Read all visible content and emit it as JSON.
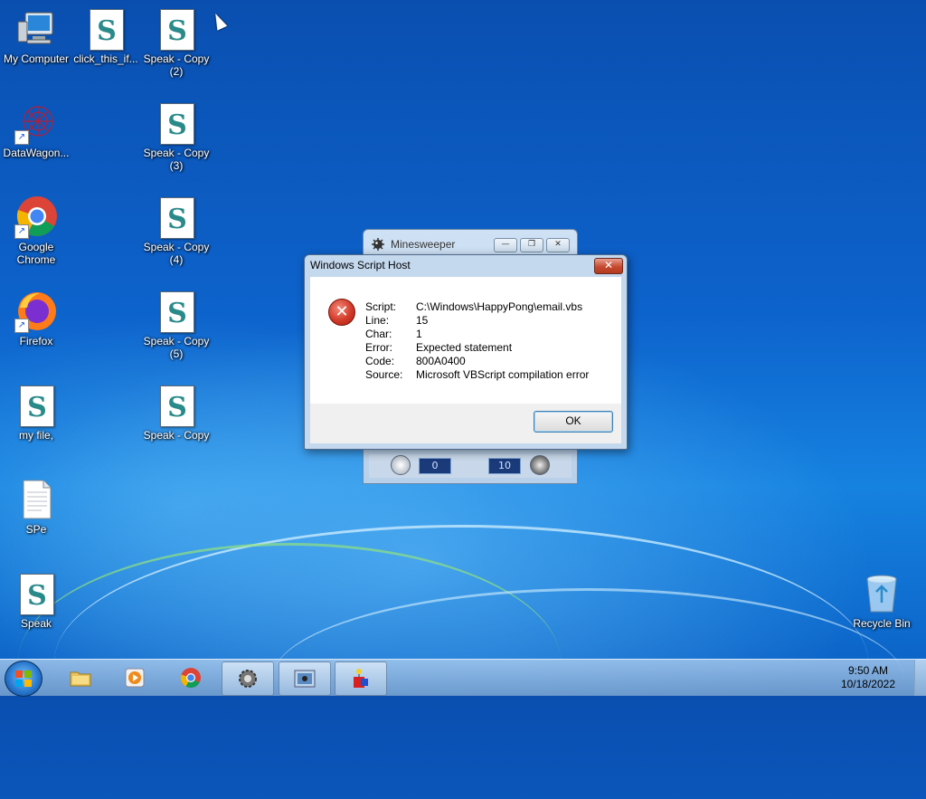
{
  "desktop": {
    "icons": [
      {
        "label": "My Computer",
        "icon": "computer-icon"
      },
      {
        "label": "click_this_if...",
        "icon": "script-file-icon"
      },
      {
        "label": "Speak - Copy\n(2)",
        "icon": "script-file-icon"
      },
      {
        "label": "DataWagon...",
        "icon": "datawagon-icon"
      },
      {
        "label": "Speak - Copy\n(3)",
        "icon": "script-file-icon"
      },
      {
        "label": "Google\nChrome",
        "icon": "chrome-icon"
      },
      {
        "label": "Speak - Copy\n(4)",
        "icon": "script-file-icon"
      },
      {
        "label": "Firefox",
        "icon": "firefox-icon"
      },
      {
        "label": "Speak - Copy\n(5)",
        "icon": "script-file-icon"
      },
      {
        "label": "my file,",
        "icon": "script-file-icon"
      },
      {
        "label": "Speak - Copy",
        "icon": "script-file-icon"
      },
      {
        "label": "SPe",
        "icon": "text-file-icon"
      },
      {
        "label": "Speak",
        "icon": "script-file-icon"
      },
      {
        "label": "Recycle Bin",
        "icon": "recycle-bin-icon"
      }
    ]
  },
  "minesweeper": {
    "title": "Minesweeper",
    "time": "0",
    "mines": "10",
    "minimize": "—",
    "restore": "❐",
    "close": "✕"
  },
  "dialog": {
    "title": "Windows Script Host",
    "close": "✕",
    "error_glyph": "✕",
    "rows": [
      {
        "key": "Script:",
        "value": "C:\\Windows\\HappyPong\\email.vbs"
      },
      {
        "key": "Line:",
        "value": "15"
      },
      {
        "key": "Char:",
        "value": "1"
      },
      {
        "key": "Error:",
        "value": "Expected statement"
      },
      {
        "key": "Code:",
        "value": "800A0400"
      },
      {
        "key": "Source:",
        "value": "Microsoft VBScript compilation error"
      }
    ],
    "ok_label": "OK"
  },
  "taskbar": {
    "time": "9:50 AM",
    "date": "10/18/2022",
    "items": [
      "file-explorer-icon",
      "media-player-icon",
      "chrome-icon",
      "settings-gear-icon",
      "minesweeper-icon",
      "script-host-icon"
    ]
  },
  "colors": {
    "desktop_blue": "#0d63cc",
    "dialog_frame": "#c4d8ee",
    "close_red": "#c64a30"
  }
}
